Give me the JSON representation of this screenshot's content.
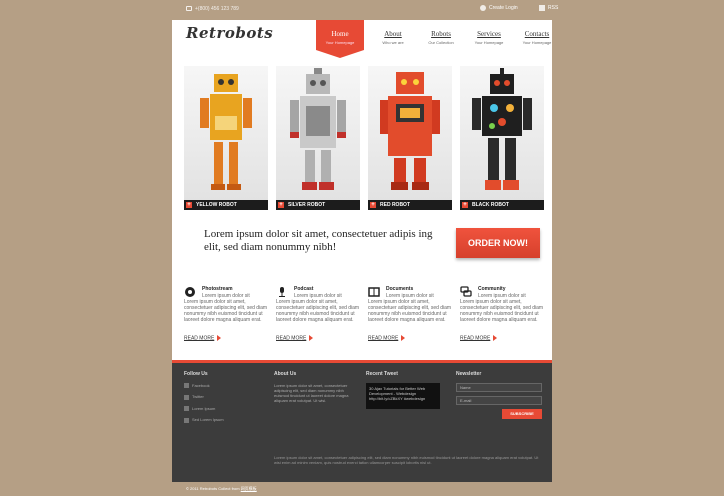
{
  "topbar": {
    "phone": "+(800) 456 123 789",
    "create_login": "Create Login",
    "rss": "RSS"
  },
  "logo": "Retrobots",
  "nav": [
    {
      "label": "Home",
      "sub": "Your Homepage"
    },
    {
      "label": "About",
      "sub": "Who we are"
    },
    {
      "label": "Robots",
      "sub": "Our Collection"
    },
    {
      "label": "Services",
      "sub": "Your Homepage"
    },
    {
      "label": "Contacts",
      "sub": "Your Homepage"
    }
  ],
  "robots": [
    {
      "name": "YELLOW ROBOT",
      "color": "#e8a420"
    },
    {
      "name": "SILVER ROBOT",
      "color": "#b8b8b8"
    },
    {
      "name": "RED ROBOT",
      "color": "#e24c2c"
    },
    {
      "name": "BLACK ROBOT",
      "color": "#1f1f1f"
    }
  ],
  "promo": {
    "text": "Lorem ipsum dolor sit amet, consectetuer adipis ing elit, sed diam nonummy nibh!",
    "button": "ORDER NOW!"
  },
  "features": [
    {
      "title": "Photostream",
      "text": "Lorem ipsum dolor sit",
      "text2": "Lorem ipsum dolor sit amet, consectetuer adipiscing elit, sed diam nonummy nibh euismod tincidunt ut laoreet dolore magna aliquam erat.",
      "more": "READ MORE",
      "icon": "aperture-icon"
    },
    {
      "title": "Podcast",
      "text": "Lorem ipsum dolor sit",
      "text2": "Lorem ipsum dolor sit amet, consectetuer adipiscing elit, sed diam nonummy nibh euismod tincidunt ut laoreet dolore magna aliquam erat.",
      "more": "READ MORE",
      "icon": "microphone-icon"
    },
    {
      "title": "Documents",
      "text": "Lorem ipsum dolor sit",
      "text2": "Lorem ipsum dolor sit amet, consectetuer adipiscing elit, sed diam nonummy nibh euismod tincidunt ut laoreet dolore magna aliquam erat.",
      "more": "READ MORE",
      "icon": "book-icon"
    },
    {
      "title": "Community",
      "text": "Lorem ipsum dolor sit",
      "text2": "Lorem ipsum dolor sit amet, consectetuer adipiscing elit, sed diam nonummy nibh euismod tincidunt ut laoreet dolore magna aliquam erat.",
      "more": "READ MORE",
      "icon": "chat-icon"
    }
  ],
  "footer": {
    "follow_us": "Follow Us",
    "follow_items": [
      "Facebook",
      "Twitter",
      "Lorem Ipsum",
      "Sed Lorem Ipsum"
    ],
    "about_us": "About Us",
    "about_text": "Lorem ipsum dolor sit amet, consectetuer adipiscing elit, sed diam nonummy nibh euismod tincidunt ut laoreet dolore magna aliquam erat volutpat. Ut wisi.",
    "recent_tweet": "Recent Tweet",
    "tweet_text": "30 Ajax Tutorials for Better Web Development - Webdesign http://bit.ly/cZBkXY #webdesign",
    "newsletter": "Newsletter",
    "name_placeholder": "Name",
    "email_placeholder": "E-mail",
    "subscribe": "SUBSCRIBE",
    "bottom_text": "Lorem ipsum dolor sit amet, consectetuer adipiscing elit, sed diam nonummy nibh euismod tincidunt ut laoreet dolore magna aliquam erat volutpat. Ut wisi enim ad minim veniam, quis nostrud exerci tation ullamcorper suscipit lobortis nisl ut."
  },
  "copyright": {
    "text": "© 2011 Retrobots Collect from",
    "link": "网页模板"
  },
  "colors": {
    "accent": "#e74a35",
    "background": "#b59f85",
    "footer": "#3c3c3c"
  }
}
